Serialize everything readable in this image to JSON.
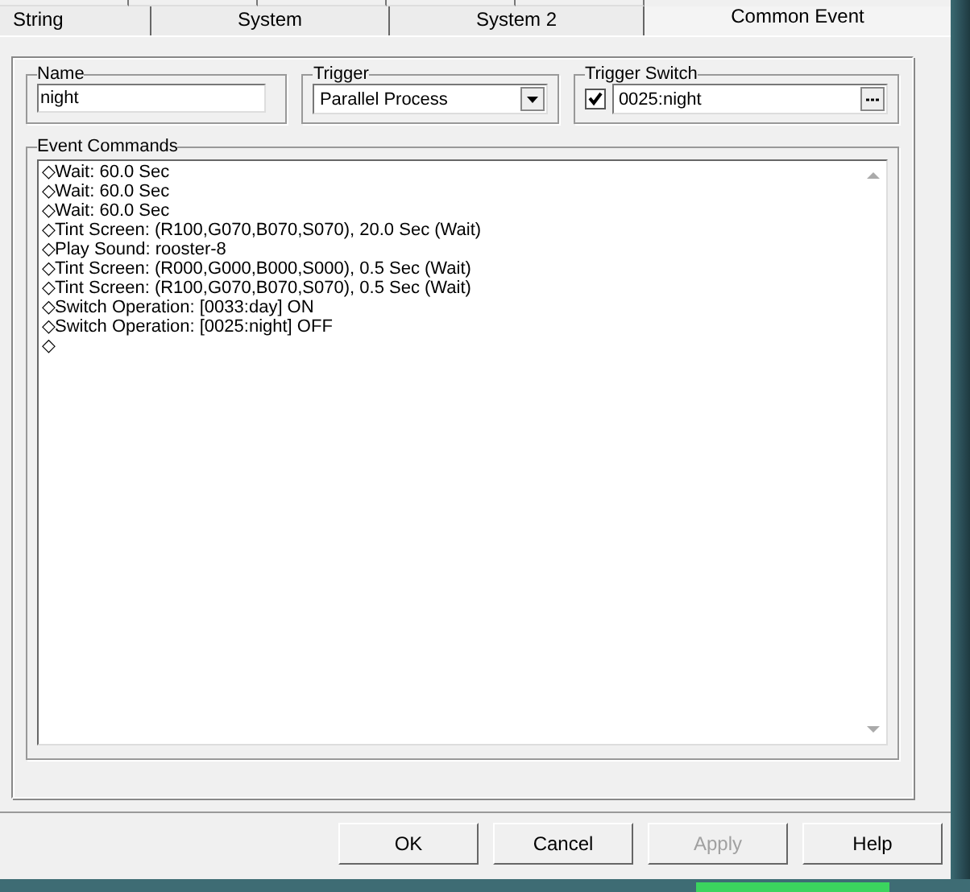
{
  "tabs": [
    {
      "label": "String",
      "selected": false
    },
    {
      "label": "System",
      "selected": false
    },
    {
      "label": "System 2",
      "selected": false
    },
    {
      "label": "Common Event",
      "selected": true
    }
  ],
  "name": {
    "label": "Name",
    "value": "night"
  },
  "trigger": {
    "label": "Trigger",
    "value": "Parallel Process"
  },
  "trigger_switch": {
    "label": "Trigger Switch",
    "checked": true,
    "value": "0025:night"
  },
  "event_commands": {
    "label": "Event Commands",
    "items": [
      "◇Wait: 60.0 Sec",
      "◇Wait: 60.0 Sec",
      "◇Wait: 60.0 Sec",
      "◇Tint Screen: (R100,G070,B070,S070), 20.0 Sec (Wait)",
      "◇Play Sound: rooster-8",
      "◇Tint Screen: (R000,G000,B000,S000), 0.5 Sec (Wait)",
      "◇Tint Screen: (R100,G070,B070,S070), 0.5 Sec (Wait)",
      "◇Switch Operation: [0033:day] ON",
      "◇Switch Operation: [0025:night] OFF",
      "◇"
    ]
  },
  "buttons": [
    {
      "label": "OK",
      "disabled": false
    },
    {
      "label": "Cancel",
      "disabled": false
    },
    {
      "label": "Apply",
      "disabled": true
    },
    {
      "label": "Help",
      "disabled": false
    }
  ]
}
